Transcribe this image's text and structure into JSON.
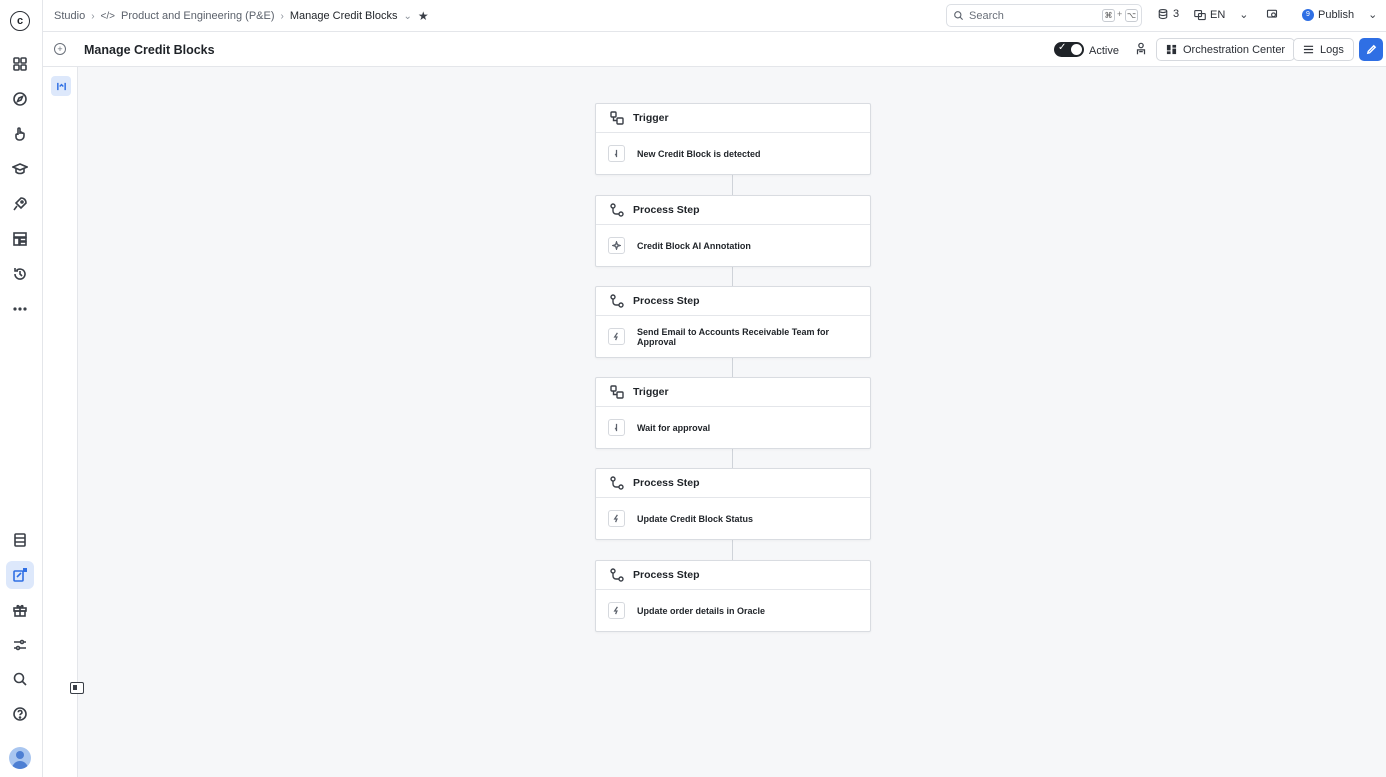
{
  "rail": {
    "logo": "c",
    "top_icons": [
      "grid-icon",
      "compass-icon",
      "hand-pointer-icon",
      "graduation-cap-icon",
      "rocket-icon",
      "layers-icon",
      "history-icon",
      "more-icon"
    ],
    "bottom_icons": [
      "database-icon",
      "orchestration-icon",
      "gift-icon",
      "sliders-icon",
      "search-icon",
      "help-icon"
    ]
  },
  "breadcrumb": {
    "items": [
      "Studio",
      "Product and Engineering (P&E)",
      "Manage Credit Blocks"
    ]
  },
  "topbar": {
    "search_placeholder": "Search",
    "shortcut_keys": [
      "⌘",
      "⌥"
    ],
    "count": "3",
    "language": "EN",
    "publish_badge": "9",
    "publish_label": "Publish"
  },
  "page": {
    "title": "Manage Credit Blocks",
    "toggle_label": "Active",
    "toggle_on": true,
    "orchestration_label": "Orchestration Center",
    "logs_label": "Logs"
  },
  "workflow": [
    {
      "type": "Trigger",
      "action": "New Credit Block is detected"
    },
    {
      "type": "Process Step",
      "action": "Credit Block AI Annotation"
    },
    {
      "type": "Process Step",
      "action": "Send Email to Accounts Receivable Team for Approval"
    },
    {
      "type": "Trigger",
      "action": "Wait for approval"
    },
    {
      "type": "Process Step",
      "action": "Update Credit Block Status"
    },
    {
      "type": "Process Step",
      "action": "Update order details in Oracle"
    }
  ],
  "colors": {
    "accent": "#2f6fe4",
    "border": "#d9dce1",
    "background": "#f6f7f9"
  }
}
